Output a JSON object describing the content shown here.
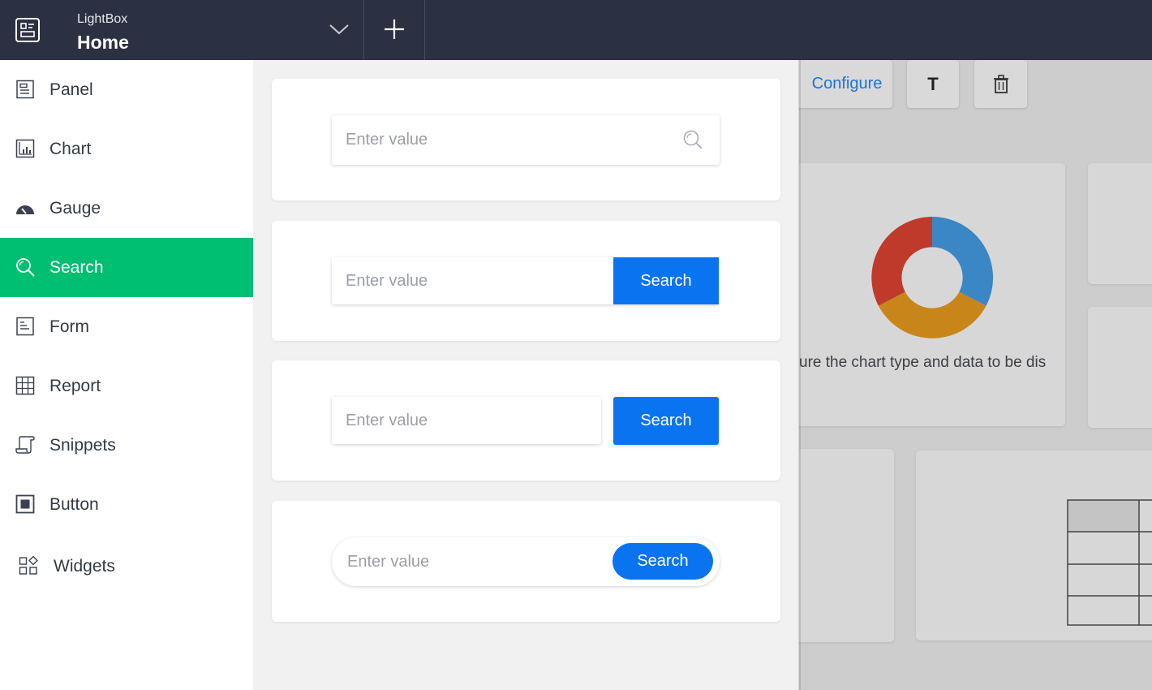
{
  "header": {
    "app_name": "LightBox",
    "page_name": "Home",
    "app_icon": "dashboard-icon",
    "dropdown_icon": "chevron-down-icon",
    "add_icon": "plus-icon",
    "background": "#2b3142"
  },
  "sidebar": {
    "items": [
      {
        "label": "Panel",
        "icon": "panel-icon"
      },
      {
        "label": "Chart",
        "icon": "chart-icon"
      },
      {
        "label": "Gauge",
        "icon": "gauge-icon"
      },
      {
        "label": "Search",
        "icon": "search-icon",
        "active": true
      },
      {
        "label": "Form",
        "icon": "form-icon"
      },
      {
        "label": "Report",
        "icon": "table-icon"
      },
      {
        "label": "Snippets",
        "icon": "scroll-icon"
      },
      {
        "label": "Button",
        "icon": "button-icon"
      },
      {
        "label": "Widgets",
        "icon": "widgets-icon"
      }
    ],
    "active_color": "#00be72"
  },
  "search_variants": [
    {
      "placeholder": "Enter value",
      "style": "inline-icon",
      "icon": "search-icon"
    },
    {
      "placeholder": "Enter value",
      "button_label": "Search",
      "style": "attached-button"
    },
    {
      "placeholder": "Enter value",
      "button_label": "Search",
      "style": "separate-button"
    },
    {
      "placeholder": "Enter value",
      "button_label": "Search",
      "style": "pill"
    }
  ],
  "accent_color": "#0a74f0",
  "dashboard": {
    "toolbar": {
      "configure_label": "Configure",
      "text_tool_label": "T",
      "delete_icon": "trash-icon"
    },
    "chart_caption": "ure the chart type and data to be dis",
    "donut_colors": [
      "#3b86c4",
      "#c8861a",
      "#c03a2b"
    ]
  }
}
